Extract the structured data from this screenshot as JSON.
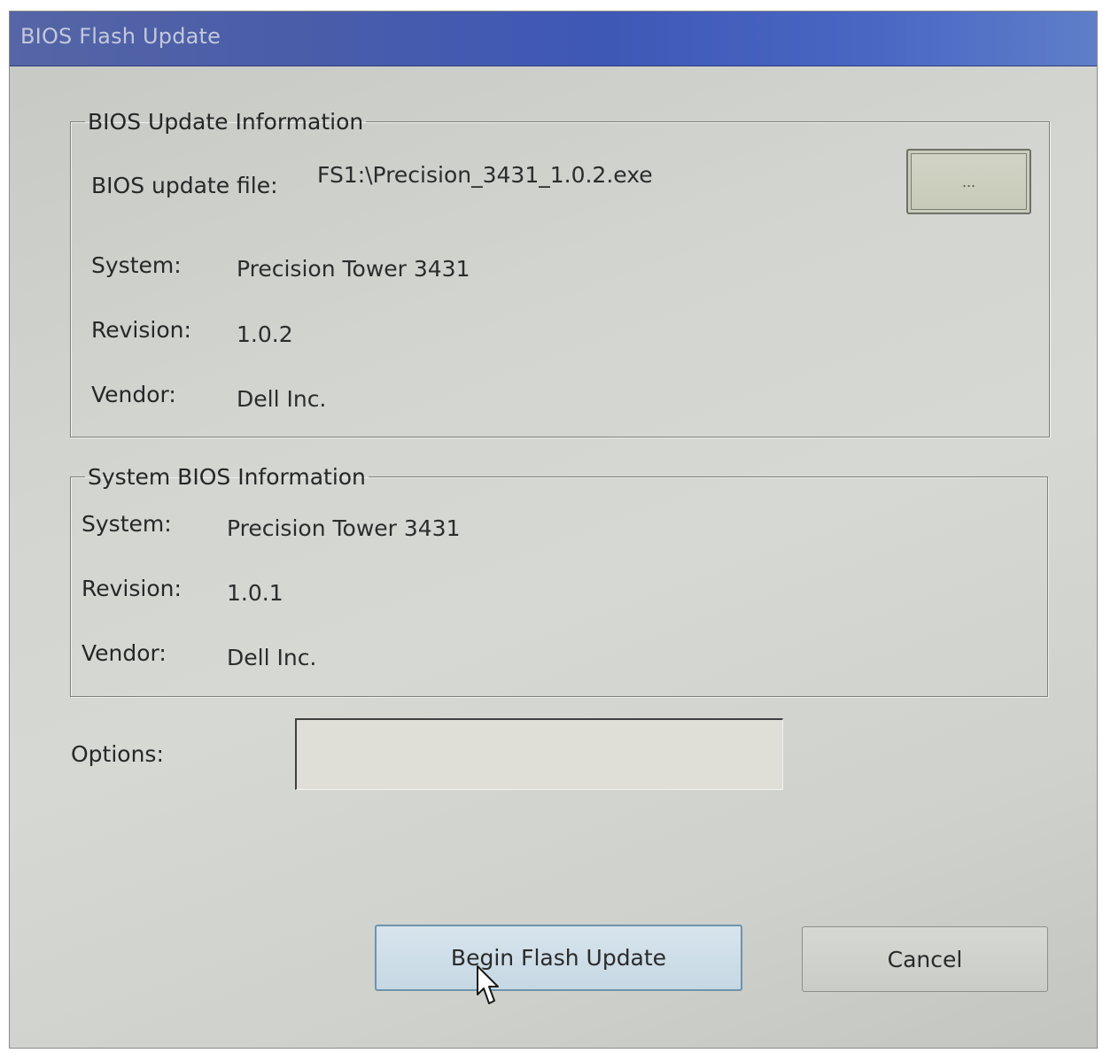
{
  "window": {
    "title": "BIOS Flash Update"
  },
  "bios_update_info": {
    "legend": "BIOS Update Information",
    "file_label": "BIOS update file:",
    "file_value": "FS1:\\Precision_3431_1.0.2.exe",
    "browse_label": "...",
    "system_label": "System:",
    "system_value": "Precision Tower 3431",
    "revision_label": "Revision:",
    "revision_value": "1.0.2",
    "vendor_label": "Vendor:",
    "vendor_value": "Dell Inc."
  },
  "system_bios_info": {
    "legend": "System BIOS Information",
    "system_label": "System:",
    "system_value": "Precision Tower 3431",
    "revision_label": "Revision:",
    "revision_value": "1.0.1",
    "vendor_label": "Vendor:",
    "vendor_value": "Dell Inc."
  },
  "options": {
    "label": "Options:",
    "value": ""
  },
  "buttons": {
    "begin_label": "Begin Flash Update",
    "cancel_label": "Cancel"
  },
  "colors": {
    "titlebar": "#3e58b6",
    "window_bg": "#d3d5d1",
    "begin_button": "#c6d8e4"
  },
  "icons": {
    "cursor": "mouse-pointer-icon"
  }
}
